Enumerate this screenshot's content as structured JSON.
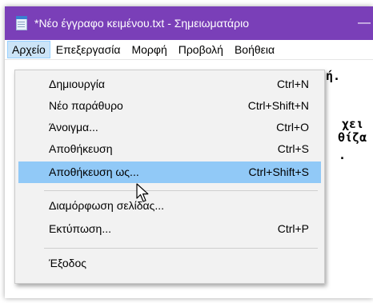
{
  "window": {
    "title": "*Νέο έγγραφο κειμένου.txt - Σημειωματάριο",
    "minimize_glyph": "—",
    "accent_color": "#7a3fb8"
  },
  "menubar": {
    "items": [
      {
        "label": "Αρχείο"
      },
      {
        "label": "Επεξεργασία"
      },
      {
        "label": "Μορφή"
      },
      {
        "label": "Προβολή"
      },
      {
        "label": "Βοήθεια"
      }
    ]
  },
  "editor": {
    "fragments": [
      "ή.",
      "χει",
      "θίζα",
      "."
    ]
  },
  "file_menu": {
    "items": [
      {
        "label": "Δημιουργία",
        "shortcut": "Ctrl+N"
      },
      {
        "label": "Νέο παράθυρο",
        "shortcut": "Ctrl+Shift+N"
      },
      {
        "label": "Άνοιγμα...",
        "shortcut": "Ctrl+O"
      },
      {
        "label": "Αποθήκευση",
        "shortcut": "Ctrl+S"
      },
      {
        "label": "Αποθήκευση ως...",
        "shortcut": "Ctrl+Shift+S"
      },
      {
        "label": "Διαμόρφωση σελίδας...",
        "shortcut": ""
      },
      {
        "label": "Εκτύπωση...",
        "shortcut": "Ctrl+P"
      },
      {
        "label": "Έξοδος",
        "shortcut": ""
      }
    ],
    "highlighted_item": "Αποθήκευση ως...",
    "highlight_color": "#91c9f7"
  },
  "icons": [
    "notepad-app-icon",
    "minimize-icon",
    "mouse-cursor-icon"
  ]
}
